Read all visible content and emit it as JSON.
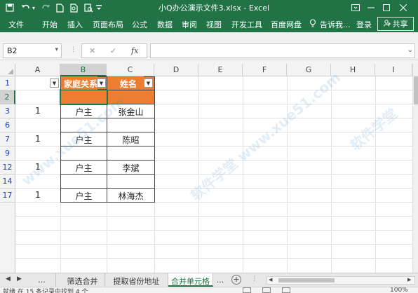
{
  "window": {
    "title": "小Q办公演示文件3.xlsx - Excel"
  },
  "ribbon": {
    "tabs": [
      "文件",
      "开始",
      "插入",
      "页面布局",
      "公式",
      "数据",
      "审阅",
      "视图",
      "开发工具",
      "百度网盘"
    ],
    "tell_me": "告诉我...",
    "login": "登录",
    "share": "共享"
  },
  "formula_bar": {
    "name_box": "B2",
    "cancel": "✕",
    "enter": "✓",
    "function": "fx",
    "content": ""
  },
  "grid": {
    "columns": [
      "A",
      "B",
      "C",
      "D",
      "E",
      "F",
      "G",
      "H",
      "I"
    ],
    "selected_column": "B",
    "rows": [
      {
        "label": "1",
        "selected": false
      },
      {
        "label": "2",
        "selected": true
      },
      {
        "label": "3",
        "selected": false
      },
      {
        "label": "6",
        "selected": false
      },
      {
        "label": "7",
        "selected": false
      },
      {
        "label": "9",
        "selected": false
      },
      {
        "label": "12",
        "selected": false
      },
      {
        "label": "14",
        "selected": false
      },
      {
        "label": "17",
        "selected": false
      }
    ],
    "header_b": "家庭关系",
    "header_c": "姓名",
    "cells": [
      {
        "a": "",
        "b": "",
        "c": ""
      },
      {
        "a": "1",
        "b": "户主",
        "c": "张金山"
      },
      {
        "a": "",
        "b": "",
        "c": ""
      },
      {
        "a": "1",
        "b": "户主",
        "c": "陈昭"
      },
      {
        "a": "",
        "b": "",
        "c": ""
      },
      {
        "a": "1",
        "b": "户主",
        "c": "李斌"
      },
      {
        "a": "",
        "b": "",
        "c": ""
      },
      {
        "a": "1",
        "b": "户主",
        "c": "林海杰"
      }
    ],
    "header_fill": "#ed7d31"
  },
  "sheets": {
    "tabs": [
      "筛选合并",
      "提取省份地址",
      "合并单元格"
    ],
    "active": 2,
    "more": "...",
    "add": "+"
  },
  "status": {
    "text": "就绪    在 15 条记录中找到 4 个",
    "zoom": "100%"
  },
  "watermark": "软件学堂 www.xue51.com",
  "colors": {
    "accent": "#217346",
    "header_fill": "#ed7d31",
    "row_header_text": "#1f3ec2"
  }
}
